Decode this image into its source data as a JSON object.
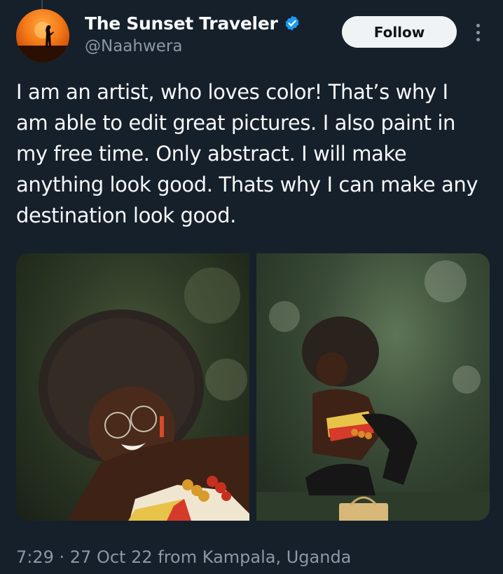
{
  "author": {
    "display_name": "The Sunset Traveler",
    "handle": "@Naahwera",
    "verified_icon": "verified-badge-icon",
    "avatar_icon": "sunset-silhouette-avatar"
  },
  "actions": {
    "follow_label": "Follow",
    "more_icon": "more-options-icon"
  },
  "tweet": {
    "text": "I am an artist, who loves color! That’s why I am able to edit great pictures. I also paint in my free time. Only abstract. I will make anything look good. Thats why I can make any destination look good.",
    "media": [
      {
        "icon": "photo-woman-laughing"
      },
      {
        "icon": "photo-woman-crouching"
      }
    ]
  },
  "meta": {
    "time": "7:29",
    "separator": " · ",
    "date": "27 Oct 22",
    "location_text": " from Kampala, Uganda"
  },
  "colors": {
    "background": "#15202b",
    "text_primary": "#f7f9f9",
    "text_secondary": "#8b98a5",
    "verified": "#1d9bf0",
    "follow_bg": "#eff3f4"
  }
}
